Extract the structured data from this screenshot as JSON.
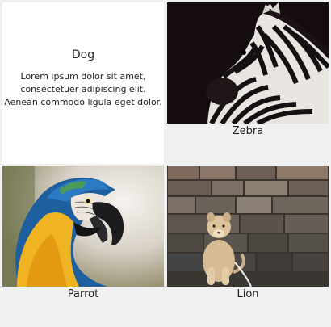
{
  "cards": [
    {
      "title": "Dog",
      "body_lines": [
        "Lorem ipsum dolor sit amet,",
        "consectetuer adipiscing elit.",
        "Aenean commodo ligula eget dolor."
      ]
    },
    {
      "caption": "Zebra",
      "image": "zebra-photo"
    },
    {
      "caption": "Parrot",
      "image": "parrot-photo"
    },
    {
      "caption": "Lion",
      "image": "lion-cub-photo"
    }
  ]
}
